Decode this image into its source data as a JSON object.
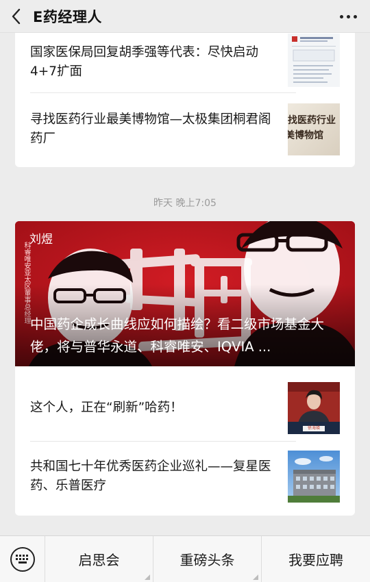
{
  "header": {
    "title": "E药经理人"
  },
  "top_card": {
    "items": [
      {
        "title": "国家医保局回复胡季强等代表：尽快启动4+7扩面"
      },
      {
        "title": "寻找医药行业最美博物馆—太极集团桐君阁药厂",
        "thumb_text_1": "找医药行业",
        "thumb_text_2": "美博物馆"
      }
    ]
  },
  "timestamp": "昨天 晚上7:05",
  "main_card": {
    "hero": {
      "title": "中国药企成长曲线应如何描绘？看二级市场基金大佬，将与普华永道、科睿唯安、IQVIA ...",
      "person_name": "刘煜",
      "person_title": "科睿唯安亚太区董事总经理",
      "bg_glyphs": "中国"
    },
    "items": [
      {
        "title": "这个人，正在“刷新”哈药！",
        "thumb_caption": "徐海瑛"
      },
      {
        "title": "共和国七十年优秀医药企业巡礼——复星医药、乐普医疗"
      }
    ]
  },
  "bottom_menu": {
    "items": [
      {
        "label": "启思会"
      },
      {
        "label": "重磅头条"
      },
      {
        "label": "我要应聘"
      }
    ]
  },
  "colors": {
    "hero_red": "#b3131b",
    "background": "#ececec"
  }
}
